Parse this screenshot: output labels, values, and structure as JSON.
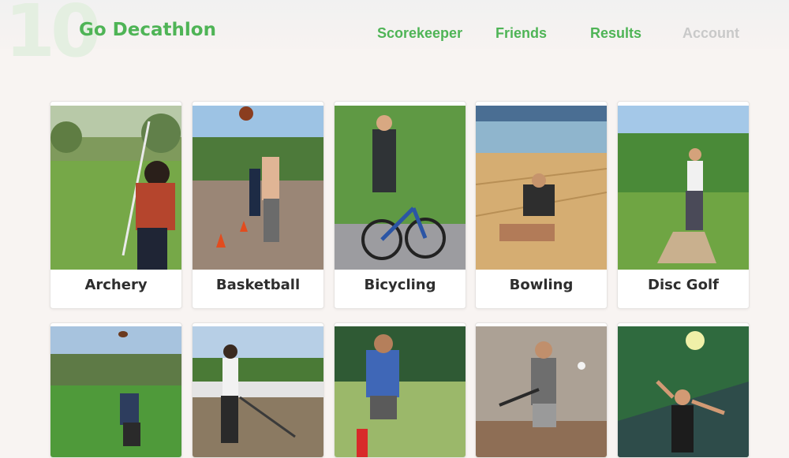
{
  "header": {
    "logo_number": "10",
    "brand": "Go Decathlon",
    "nav": [
      {
        "label": "Scorekeeper",
        "state": "active"
      },
      {
        "label": "Friends",
        "state": "active"
      },
      {
        "label": "Results",
        "state": "active"
      },
      {
        "label": "Account",
        "state": "muted"
      }
    ]
  },
  "colors": {
    "brand_green": "#4fb456",
    "muted_nav": "#c9c9c9",
    "background": "#f8f4f2"
  },
  "activities": [
    {
      "name": "Archery",
      "photo": "archery-photo"
    },
    {
      "name": "Basketball",
      "photo": "basketball-photo"
    },
    {
      "name": "Bicycling",
      "photo": "bicycling-photo"
    },
    {
      "name": "Bowling",
      "photo": "bowling-photo"
    },
    {
      "name": "Disc Golf",
      "photo": "disc-golf-photo"
    },
    {
      "name": "",
      "photo": "football-photo"
    },
    {
      "name": "",
      "photo": "hockey-photo"
    },
    {
      "name": "",
      "photo": "kickball-photo"
    },
    {
      "name": "",
      "photo": "softball-photo"
    },
    {
      "name": "",
      "photo": "volleyball-photo"
    }
  ]
}
